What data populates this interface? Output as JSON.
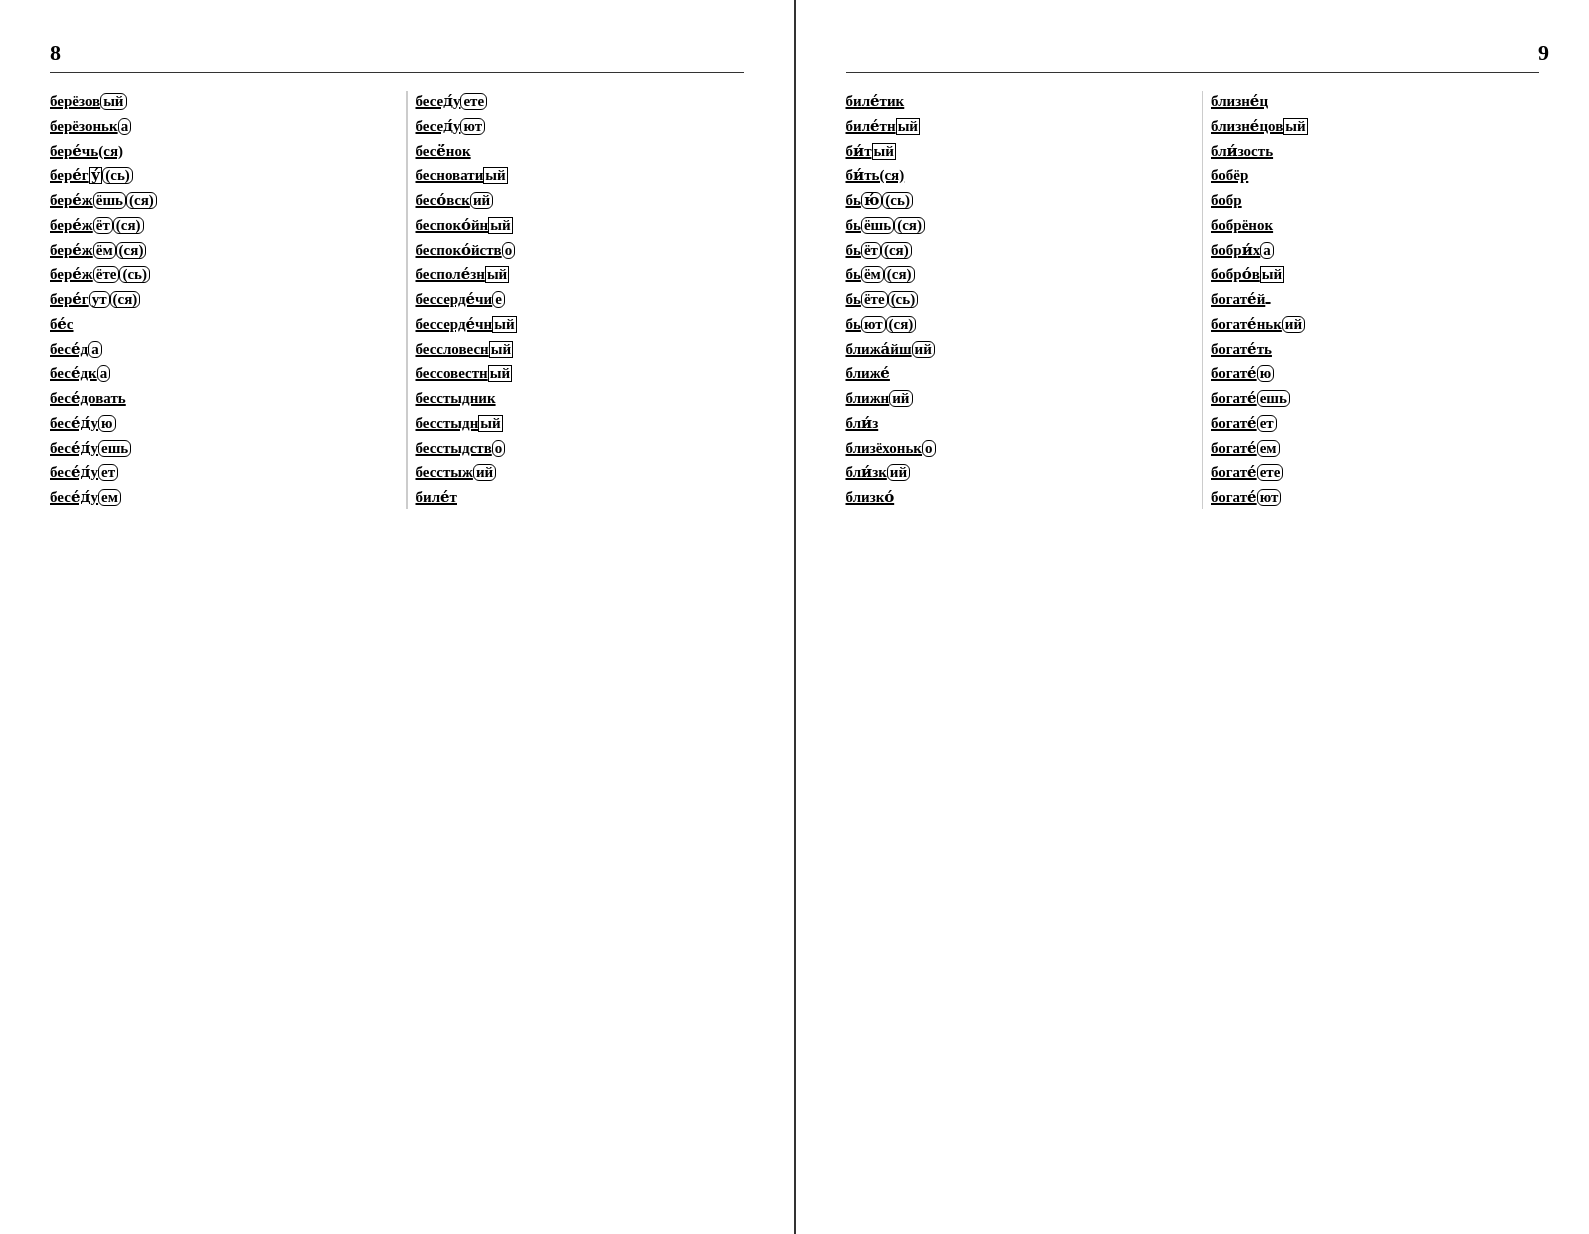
{
  "pages": {
    "left": {
      "number": "8",
      "col1": [
        {
          "html": "<span class='root'>берёзов</span><span class='ending'>ый</span>"
        },
        {
          "html": "<span class='root'>берёзоньк</span><span class='ending'>а</span>"
        },
        {
          "html": "<span class='root bold'>бере&#769;чь(ся)</span>"
        },
        {
          "html": "<span class='root'>бере&#769;г</span><span class='suffix'>у&#769;</span><span class='ending'>(сь)</span>"
        },
        {
          "html": "<span class='root'>бере&#769;ж</span><span class='ending'>ёшь</span><span class='ending'>(ся)</span>"
        },
        {
          "html": "<span class='root'>бере&#769;ж</span><span class='ending'>ёт</span><span class='ending'>(ся)</span>"
        },
        {
          "html": "<span class='root'>бере&#769;ж</span><span class='ending'>ём</span><span class='ending'>(ся)</span>"
        },
        {
          "html": "<span class='root'>бере&#769;ж</span><span class='ending'>ёте</span><span class='ending'>(сь)</span>"
        },
        {
          "html": "<span class='root'>бере&#769;г</span><span class='ending'>ут</span><span class='ending'>(ся)</span>"
        },
        {
          "html": "<span class='root bold'>бе&#769;с</span>"
        },
        {
          "html": "<span class='root bold'>бесе&#769;д</span><span class='ending'>а</span>"
        },
        {
          "html": "<span class='root bold'>бесе&#769;дк</span><span class='ending'>а</span>"
        },
        {
          "html": "<span class='root bold'>бесе&#769;довать</span>"
        },
        {
          "html": "<span class='root'>бесе&#769;д&#769;у</span><span class='ending'>ю</span>"
        },
        {
          "html": "<span class='root'>бесе&#769;д&#769;у</span><span class='ending'>ешь</span>"
        },
        {
          "html": "<span class='root'>бесе&#769;д&#769;у</span><span class='ending'>ет</span>"
        },
        {
          "html": "<span class='root'>бесе&#769;д&#769;у</span><span class='ending'>ем</span>"
        }
      ],
      "col2": [
        {
          "html": "<span class='root'>бесед&#769;у</span><span class='ending'>ете</span>"
        },
        {
          "html": "<span class='root'>бесед&#769;у</span><span class='ending'>ют</span>"
        },
        {
          "html": "<span class='root bold'>бесё&#769;нок</span>"
        },
        {
          "html": "<span class='root bold'>бесновати</span><span class='suffix'>ый</span>"
        },
        {
          "html": "<span class='root bold'>бесо&#769;вск</span><span class='ending'>ий</span>"
        },
        {
          "html": "<span class='root bold'>беспоко&#769;йн</span><span class='suffix'>ый</span>"
        },
        {
          "html": "<span class='root bold'>беспоко&#769;йств</span><span class='ending'>о</span>"
        },
        {
          "html": "<span class='root bold'>бесполе&#769;зн</span><span class='suffix'>ый</span>"
        },
        {
          "html": "<span class='root bold'>бессерде&#769;чи</span><span class='ending'>е</span>"
        },
        {
          "html": "<span class='root bold'>бессерде&#769;чн</span><span class='suffix'>ый</span>"
        },
        {
          "html": "<span class='root bold'>бессловесн</span><span class='suffix'>ый</span>"
        },
        {
          "html": "<span class='root bold'>бессовестн</span><span class='suffix'>ый</span>"
        },
        {
          "html": "<span class='root bold'>бесстыдник</span>"
        },
        {
          "html": "<span class='root bold'>бесстыдн</span><span class='suffix'>ый</span>"
        },
        {
          "html": "<span class='root bold'>бесстыдств</span><span class='ending'>о</span>"
        },
        {
          "html": "<span class='root bold'>бесстыж</span><span class='ending'>ий</span>"
        },
        {
          "html": "<span class='root bold'>биле&#769;т</span>"
        }
      ]
    },
    "right": {
      "number": "9",
      "col1": [
        {
          "html": "<span class='root bold'>биле&#769;тик</span>"
        },
        {
          "html": "<span class='root bold'>биле&#769;тн</span><span class='suffix'>ый</span>"
        },
        {
          "html": "<span class='root bold'>би&#769;т</span><span class='suffix'>ый</span>"
        },
        {
          "html": "<span class='root bold'>би&#769;ть(ся)</span>"
        },
        {
          "html": "<span class='root'>бь</span><span class='ending'>ю&#769;</span><span class='ending'>(сь)</span>"
        },
        {
          "html": "<span class='root'>бь</span><span class='ending'>ёшь</span><span class='ending'>(ся)</span>"
        },
        {
          "html": "<span class='root'>бь</span><span class='ending'>ёт</span><span class='ending'>(ся)</span>"
        },
        {
          "html": "<span class='root'>бь</span><span class='ending'>ём</span><span class='ending'>(ся)</span>"
        },
        {
          "html": "<span class='root'>бь</span><span class='ending'>ёте</span><span class='ending'>(сь)</span>"
        },
        {
          "html": "<span class='root'>бь</span><span class='ending'>ют</span><span class='ending'>(ся)</span>"
        },
        {
          "html": "<span class='root bold'>ближа&#769;йш</span><span class='ending'>ий</span>"
        },
        {
          "html": "<span class='root bold'>ближе&#769;</span>"
        },
        {
          "html": "<span class='root bold'>ближн</span><span class='ending'>ий</span>"
        },
        {
          "html": "<span class='root bold'>бли&#769;з</span>"
        },
        {
          "html": "<span class='root bold'>близёхоньк</span><span class='ending'>о</span>"
        },
        {
          "html": "<span class='root bold'>бли&#769;зк</span><span class='ending'>ий</span>"
        },
        {
          "html": "<span class='root bold'>близко&#769;</span>"
        }
      ],
      "col2": [
        {
          "html": "<span class='root bold'>близне&#769;ц</span>"
        },
        {
          "html": "<span class='root bold'>близне&#769;цов</span><span class='suffix'>ый</span>"
        },
        {
          "html": "<span class='root bold'>бли&#769;зость</span>"
        },
        {
          "html": "<span class='root bold'>бобёр</span>"
        },
        {
          "html": "<span class='root bold'>бобр</span>"
        },
        {
          "html": "<span class='root bold'>бобрёнок</span>"
        },
        {
          "html": "<span class='root bold'>бобри&#769;х</span><span class='ending'>а</span>"
        },
        {
          "html": "<span class='root bold'>бобро&#769;в</span><span class='suffix'>ый</span>"
        },
        {
          "html": "<span class='root bold'>богате&#769;й</span><span class='ending'></span>"
        },
        {
          "html": "<span class='root bold'>богате&#769;ньк</span><span class='ending'>ий</span>"
        },
        {
          "html": "<span class='root bold'>богате&#769;ть</span>"
        },
        {
          "html": "<span class='root'>богате&#769;</span><span class='ending'>ю</span>"
        },
        {
          "html": "<span class='root'>богате&#769;</span><span class='ending'>ешь</span>"
        },
        {
          "html": "<span class='root'>богате&#769;</span><span class='ending'>ет</span>"
        },
        {
          "html": "<span class='root'>богате&#769;</span><span class='ending'>ем</span>"
        },
        {
          "html": "<span class='root'>богате&#769;</span><span class='ending'>ете</span>"
        },
        {
          "html": "<span class='root'>богате&#769;</span><span class='ending'>ют</span>"
        }
      ]
    }
  }
}
